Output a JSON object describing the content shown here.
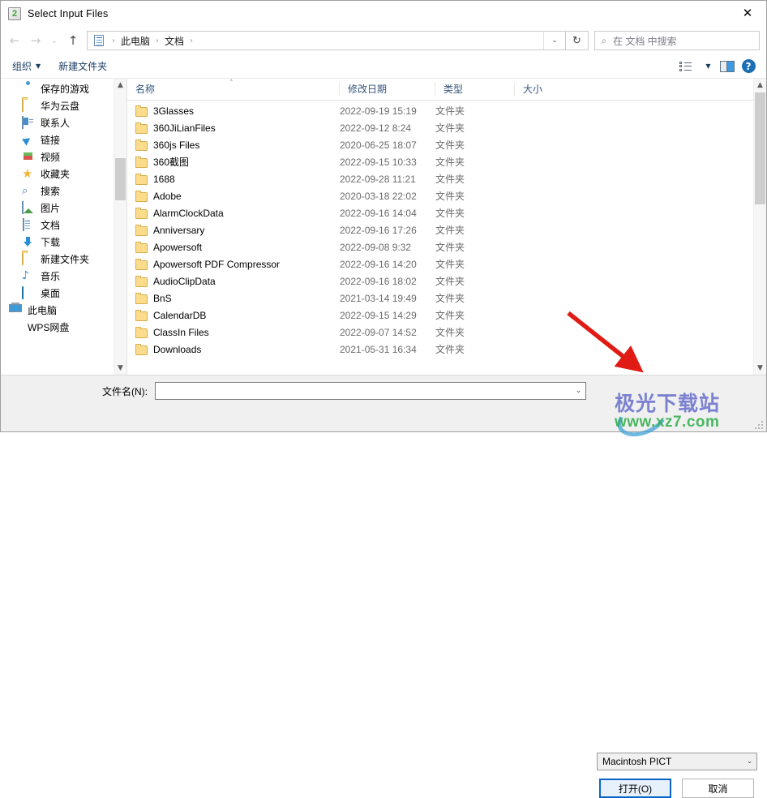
{
  "window": {
    "title": "Select Input Files",
    "app_icon": "2",
    "close_label": "✕"
  },
  "nav": {
    "back": "←",
    "forward": "→",
    "recent": "⌄",
    "up": "↑",
    "address_chevron": "⌄",
    "refresh": "↻",
    "breadcrumbs": [
      "此电脑",
      "文档"
    ],
    "separator": "›",
    "search_placeholder": "在 文档 中搜索",
    "search_icon": "⌕"
  },
  "commandbar": {
    "organize": "组织",
    "organize_caret": "▼",
    "new_folder": "新建文件夹",
    "view_caret": "▼",
    "help": "?"
  },
  "sidebar": {
    "items": [
      {
        "label": "保存的游戏",
        "icon": "gamepad-icon"
      },
      {
        "label": "华为云盘",
        "icon": "folder-icon"
      },
      {
        "label": "联系人",
        "icon": "contacts-icon"
      },
      {
        "label": "链接",
        "icon": "link-icon"
      },
      {
        "label": "视频",
        "icon": "video-icon"
      },
      {
        "label": "收藏夹",
        "icon": "star-icon"
      },
      {
        "label": "搜索",
        "icon": "search-icon"
      },
      {
        "label": "图片",
        "icon": "pictures-icon"
      },
      {
        "label": "文档",
        "icon": "documents-icon"
      },
      {
        "label": "下载",
        "icon": "download-icon"
      },
      {
        "label": "新建文件夹",
        "icon": "folder-icon"
      },
      {
        "label": "音乐",
        "icon": "music-icon"
      },
      {
        "label": "桌面",
        "icon": "desktop-icon"
      },
      {
        "label": "此电脑",
        "icon": "pc-icon"
      },
      {
        "label": "WPS网盘",
        "icon": "cloud-icon"
      }
    ]
  },
  "filelist": {
    "columns": {
      "name": "名称",
      "date": "修改日期",
      "type": "类型",
      "size": "大小"
    },
    "sort_caret": "˄",
    "rows": [
      {
        "name": "3Glasses",
        "date": "2022-09-19 15:19",
        "type": "文件夹",
        "size": ""
      },
      {
        "name": "360JiLianFiles",
        "date": "2022-09-12 8:24",
        "type": "文件夹",
        "size": ""
      },
      {
        "name": "360js Files",
        "date": "2020-06-25 18:07",
        "type": "文件夹",
        "size": ""
      },
      {
        "name": "360截图",
        "date": "2022-09-15 10:33",
        "type": "文件夹",
        "size": ""
      },
      {
        "name": "1688",
        "date": "2022-09-28 11:21",
        "type": "文件夹",
        "size": ""
      },
      {
        "name": "Adobe",
        "date": "2020-03-18 22:02",
        "type": "文件夹",
        "size": ""
      },
      {
        "name": "AlarmClockData",
        "date": "2022-09-16 14:04",
        "type": "文件夹",
        "size": ""
      },
      {
        "name": "Anniversary",
        "date": "2022-09-16 17:26",
        "type": "文件夹",
        "size": ""
      },
      {
        "name": "Apowersoft",
        "date": "2022-09-08 9:32",
        "type": "文件夹",
        "size": ""
      },
      {
        "name": "Apowersoft PDF Compressor",
        "date": "2022-09-16 14:20",
        "type": "文件夹",
        "size": ""
      },
      {
        "name": "AudioClipData",
        "date": "2022-09-16 18:02",
        "type": "文件夹",
        "size": ""
      },
      {
        "name": "BnS",
        "date": "2021-03-14 19:49",
        "type": "文件夹",
        "size": ""
      },
      {
        "name": "CalendarDB",
        "date": "2022-09-15 14:29",
        "type": "文件夹",
        "size": ""
      },
      {
        "name": "ClassIn Files",
        "date": "2022-09-07 14:52",
        "type": "文件夹",
        "size": ""
      },
      {
        "name": "Downloads",
        "date": "2021-05-31 16:34",
        "type": "文件夹",
        "size": ""
      }
    ]
  },
  "footer": {
    "filename_label": "文件名(N):",
    "filename_value": "",
    "filetype_value": "Macintosh PICT",
    "combo_caret": "⌄",
    "open_button": "打开(O)",
    "cancel_button": "取消"
  },
  "annotation": {
    "arrow_color": "#e01b15"
  },
  "watermark": {
    "cn": "极光下载站",
    "en": "www.xz7.com"
  }
}
